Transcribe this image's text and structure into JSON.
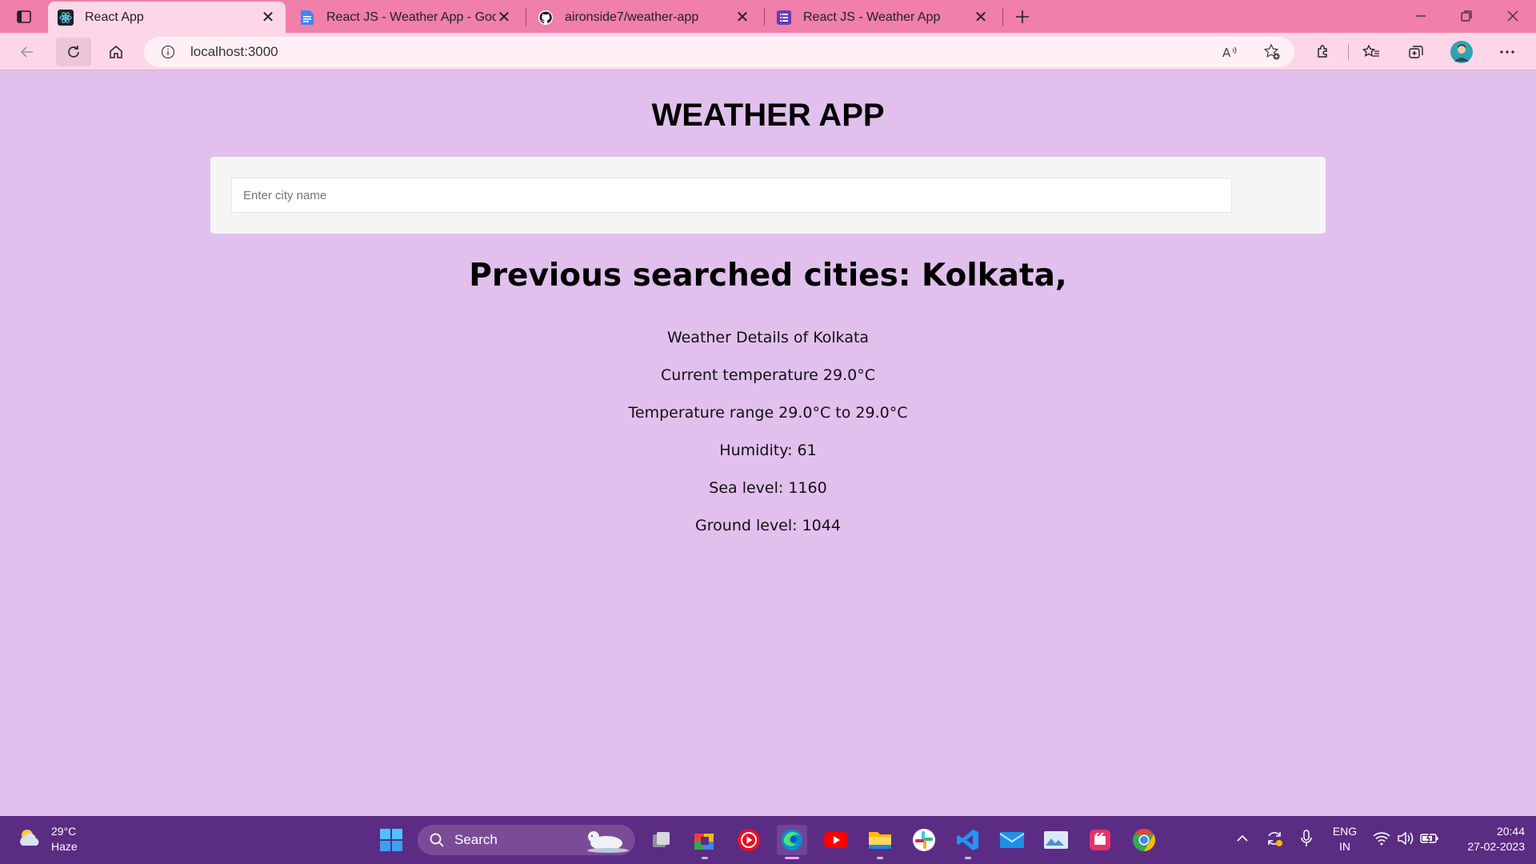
{
  "browser": {
    "tabs": [
      {
        "title": "React App",
        "active": true
      },
      {
        "title": "React JS - Weather App - Google",
        "active": false
      },
      {
        "title": "aironside7/weather-app",
        "active": false
      },
      {
        "title": "React JS - Weather App",
        "active": false
      }
    ],
    "address": "localhost:3000"
  },
  "page": {
    "title": "WEATHER APP",
    "search_placeholder": "Enter city name",
    "previous_searched": "Previous searched cities: Kolkata,",
    "details": [
      "Weather Details of Kolkata",
      "Current temperature 29.0°C",
      "Temperature range 29.0°C to 29.0°C",
      "Humidity: 61",
      "Sea level: 1160",
      "Ground level: 1044"
    ]
  },
  "taskbar": {
    "weather_temp": "29°C",
    "weather_desc": "Haze",
    "search_label": "Search",
    "lang_line1": "ENG",
    "lang_line2": "IN",
    "time": "20:44",
    "date": "27-02-2023"
  },
  "colors": {
    "tabstrip": "#f07fa9",
    "toolbar": "#fdd7e7",
    "page_background": "#e1c0ed",
    "taskbar": "#5b2c83"
  }
}
